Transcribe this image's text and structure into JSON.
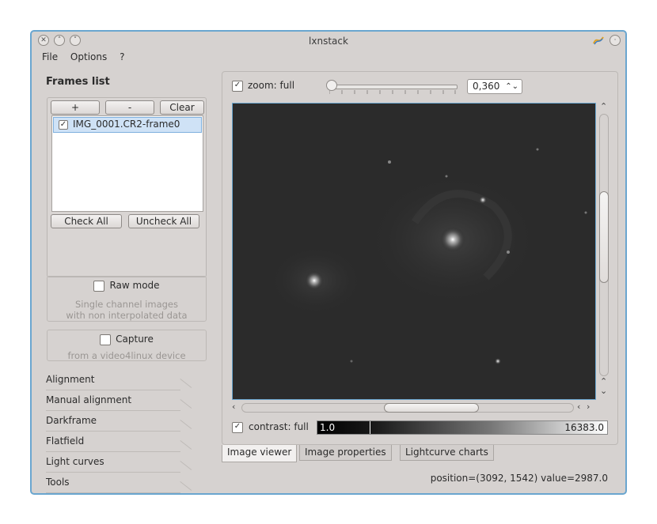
{
  "window": {
    "title": "lxnstack"
  },
  "menu": [
    "File",
    "Options",
    "?"
  ],
  "frames": {
    "title": "Frames list",
    "add_label": "+",
    "remove_label": "-",
    "clear_label": "Clear",
    "items": [
      {
        "label": "IMG_0001.CR2-frame0",
        "checked": true
      }
    ],
    "check_all_label": "Check All",
    "uncheck_all_label": "Uncheck All"
  },
  "raw_mode": {
    "label": "Raw mode",
    "desc_line1": "Single channel images",
    "desc_line2": "with non interpolated data"
  },
  "capture": {
    "label": "Capture",
    "desc": "from a video4linux device"
  },
  "toolbox": [
    "Alignment",
    "Manual alignment",
    "Darkframe",
    "Flatfield",
    "Light curves",
    "Tools"
  ],
  "viewer": {
    "zoom_label": "zoom: full",
    "zoom_value": "0,360",
    "zoom_slider_fraction": 0.0,
    "contrast_label": "contrast: full",
    "contrast_min": "1.0",
    "contrast_max": "16383.0"
  },
  "tabs": [
    "Image viewer",
    "Image properties",
    "Lightcurve charts"
  ],
  "active_tab": "Image viewer",
  "status": "position=(3092, 1542) value=2987.0",
  "colors": {
    "accent": "#6aa6cf",
    "window_bg": "#d6d2d0",
    "selection": "#cfe2f6"
  }
}
